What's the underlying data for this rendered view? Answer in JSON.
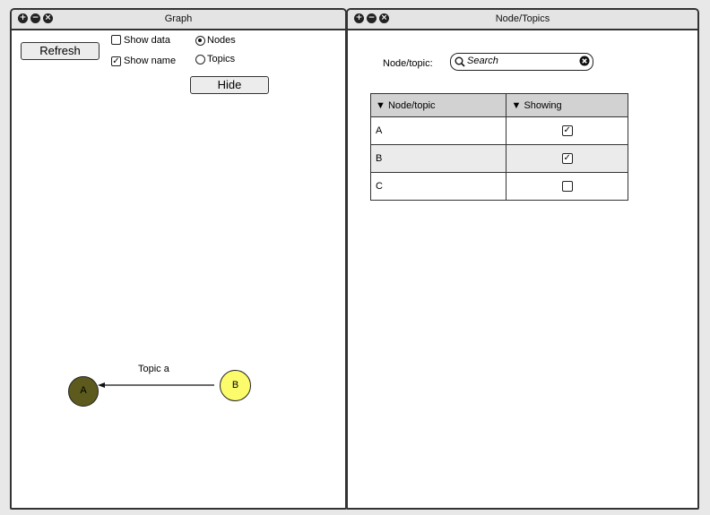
{
  "graph_window": {
    "title": "Graph",
    "refresh_label": "Refresh",
    "show_data_label": "Show data",
    "show_data_checked": false,
    "show_name_label": "Show name",
    "show_name_checked": true,
    "radio_nodes_label": "Nodes",
    "radio_topics_label": "Topics",
    "selected_mode": "Nodes",
    "hide_label": "Hide",
    "graph": {
      "edge_label": "Topic a",
      "node_a": {
        "label": "A",
        "color": "#5c5a1c"
      },
      "node_b": {
        "label": "B",
        "color": "#fcfb6b"
      }
    }
  },
  "nodes_window": {
    "title": "Node/Topics",
    "filter_label": "Node/topic:",
    "search_placeholder": "Search",
    "columns": [
      "Node/topic",
      "Showing"
    ],
    "rows": [
      {
        "name": "A",
        "showing": true
      },
      {
        "name": "B",
        "showing": true
      },
      {
        "name": "C",
        "showing": false
      }
    ]
  }
}
